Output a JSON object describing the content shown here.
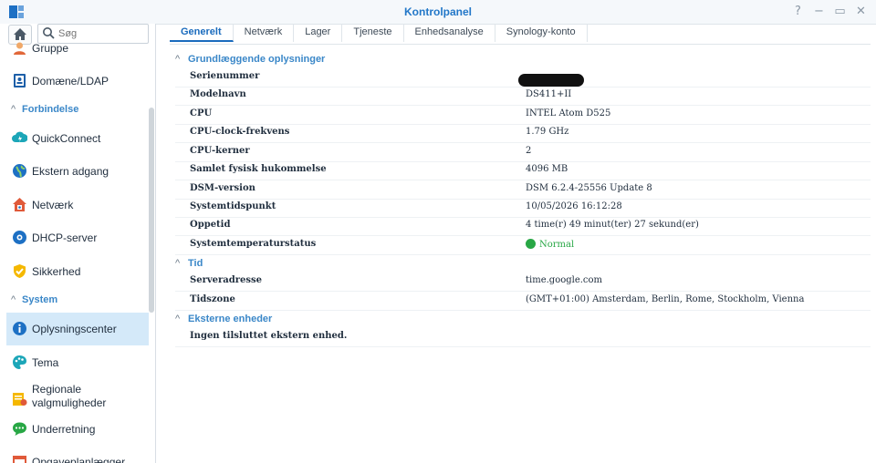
{
  "window": {
    "title": "Kontrolpanel",
    "buttons": [
      "?",
      "−",
      "▭",
      "✕"
    ]
  },
  "search": {
    "placeholder": "Søg"
  },
  "sidebar": {
    "items": [
      {
        "label": "Gruppe",
        "icon": "group-icon"
      },
      {
        "label": "Domæne/LDAP",
        "icon": "domain-ldap-icon"
      },
      {
        "section": "Forbindelse"
      },
      {
        "label": "QuickConnect",
        "icon": "quickconnect-icon"
      },
      {
        "label": "Ekstern adgang",
        "icon": "external-access-icon"
      },
      {
        "label": "Netværk",
        "icon": "network-icon"
      },
      {
        "label": "DHCP-server",
        "icon": "dhcp-server-icon"
      },
      {
        "label": "Sikkerhed",
        "icon": "security-shield-icon"
      },
      {
        "section": "System"
      },
      {
        "label": "Oplysningscenter",
        "icon": "info-center-icon",
        "active": true
      },
      {
        "label": "Tema",
        "icon": "theme-palette-icon"
      },
      {
        "label": "Regionale valgmuligheder",
        "icon": "regional-options-icon"
      },
      {
        "label": "Underretning",
        "icon": "notification-icon"
      },
      {
        "label": "Opgaveplanlægger",
        "icon": "task-scheduler-icon"
      }
    ]
  },
  "tabs": [
    {
      "label": "Generelt",
      "active": true
    },
    {
      "label": "Netværk"
    },
    {
      "label": "Lager"
    },
    {
      "label": "Tjeneste"
    },
    {
      "label": "Enhedsanalyse"
    },
    {
      "label": "Synology-konto"
    }
  ],
  "groups": {
    "basic": {
      "title": "Grundlæggende oplysninger",
      "rows": [
        {
          "key": "Serienummer",
          "value": ""
        },
        {
          "key": "Modelnavn",
          "value": "DS411+II"
        },
        {
          "key": "CPU",
          "value": "INTEL Atom D525"
        },
        {
          "key": "CPU-clock-frekvens",
          "value": "1.79 GHz"
        },
        {
          "key": "CPU-kerner",
          "value": "2"
        },
        {
          "key": "Samlet fysisk hukommelse",
          "value": "4096 MB"
        },
        {
          "key": "DSM-version",
          "value": "DSM 6.2.4-25556 Update 8"
        },
        {
          "key": "Systemtidspunkt",
          "value": "10/05/2026 16:12:28"
        },
        {
          "key": "Oppetid",
          "value": "4 time(r) 49 minut(ter) 27 sekund(er)"
        },
        {
          "key": "Systemtemperaturstatus",
          "value": "Normal"
        }
      ]
    },
    "time": {
      "title": "Tid",
      "rows": [
        {
          "key": "Serveradresse",
          "value": "time.google.com"
        },
        {
          "key": "Tidszone",
          "value": "(GMT+01:00) Amsterdam, Berlin, Rome, Stockholm, Vienna"
        }
      ]
    },
    "external": {
      "title": "Eksterne enheder",
      "message": "Ingen tilsluttet ekstern enhed."
    }
  },
  "colors": {
    "accent": "#1a6bbd",
    "section": "#3a87c8",
    "active_bg": "#d4e9f9",
    "ok": "#28a745"
  }
}
